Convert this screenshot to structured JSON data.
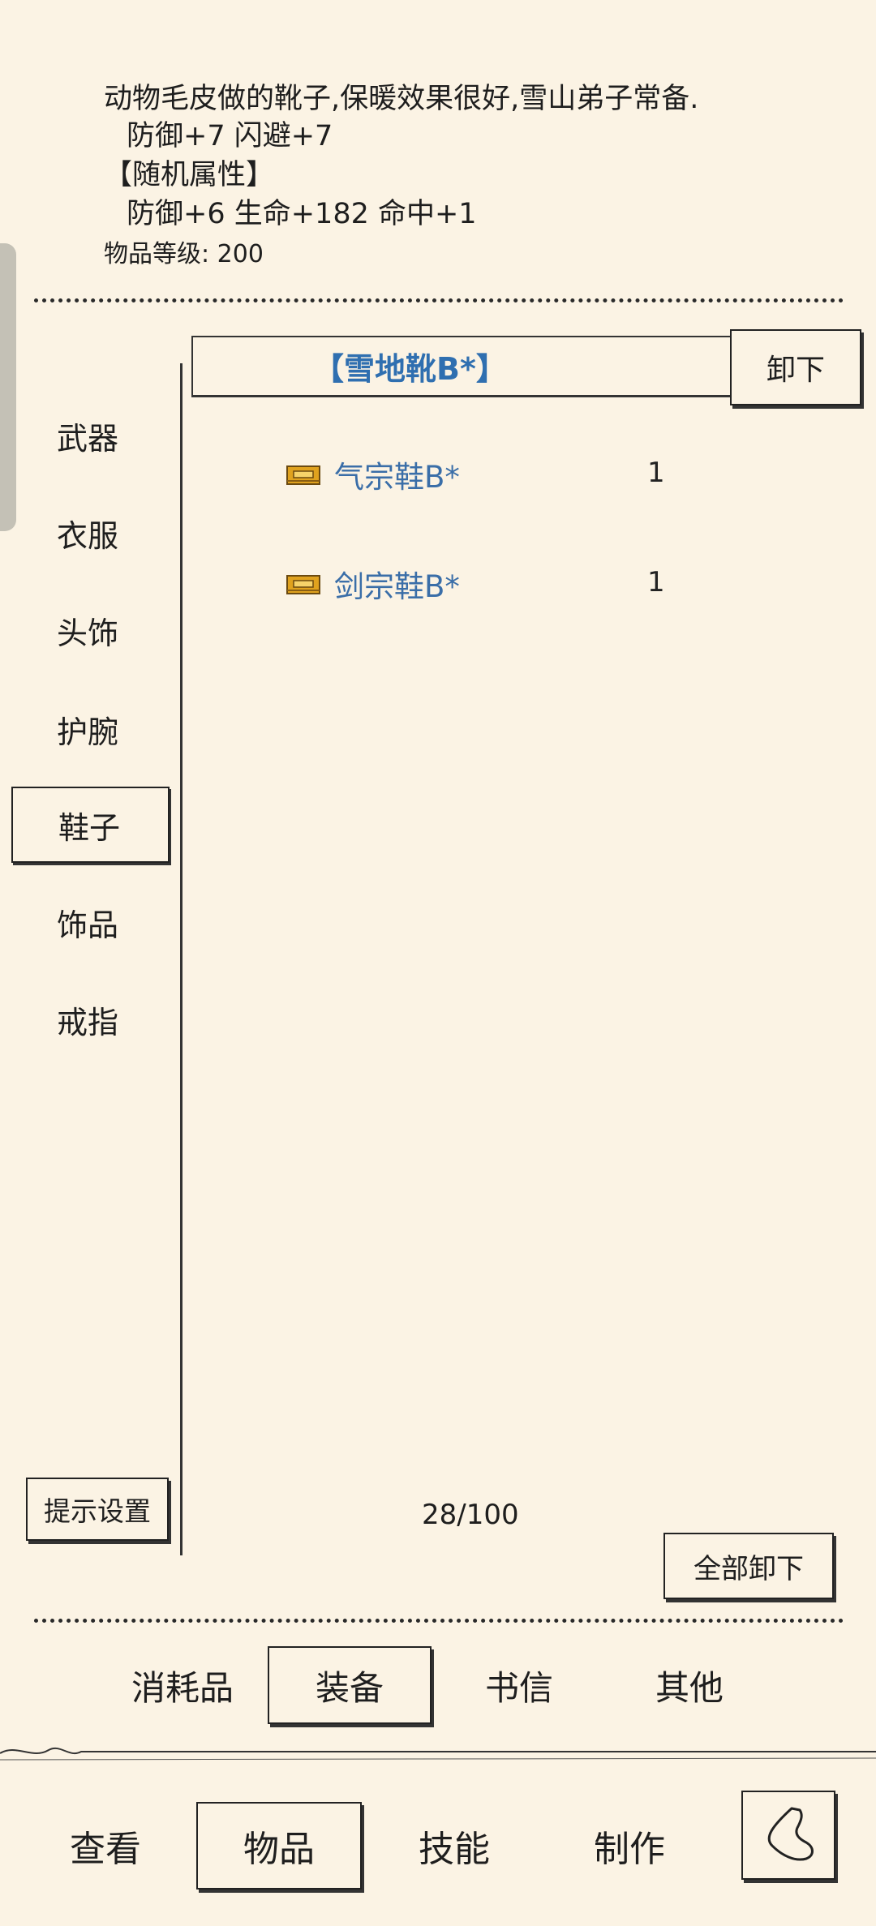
{
  "description": {
    "text": "动物毛皮做的靴子,保暖效果很好,雪山弟子常备.",
    "base_stats": "防御+7 闪避+7",
    "random_header": "【随机属性】",
    "random_stats": "防御+6 生命+182 命中+1",
    "item_level": "物品等级: 200"
  },
  "categories": [
    {
      "label": "武器"
    },
    {
      "label": "衣服"
    },
    {
      "label": "头饰"
    },
    {
      "label": "护腕"
    },
    {
      "label": "鞋子",
      "active": true
    },
    {
      "label": "饰品"
    },
    {
      "label": "戒指"
    }
  ],
  "equipped": {
    "name": "【雪地靴B*】",
    "unequip_label": "卸下"
  },
  "items": [
    {
      "name": "气宗鞋B*",
      "qty": "1",
      "icon": "boot-icon"
    },
    {
      "name": "剑宗鞋B*",
      "qty": "1",
      "icon": "boot-icon"
    }
  ],
  "hint_settings_label": "提示设置",
  "capacity": "28/100",
  "unequip_all_label": "全部卸下",
  "sub_tabs": [
    {
      "label": "消耗品"
    },
    {
      "label": "装备",
      "active": true
    },
    {
      "label": "书信"
    },
    {
      "label": "其他"
    }
  ],
  "main_tabs": [
    {
      "label": "查看"
    },
    {
      "label": "物品",
      "active": true
    },
    {
      "label": "技能"
    },
    {
      "label": "制作"
    }
  ],
  "back_icon": "back-arrow-icon",
  "colors": {
    "background": "#fbf3e4",
    "item_blue": "#3a6ea8",
    "equipped_blue": "#2f6fb0"
  }
}
